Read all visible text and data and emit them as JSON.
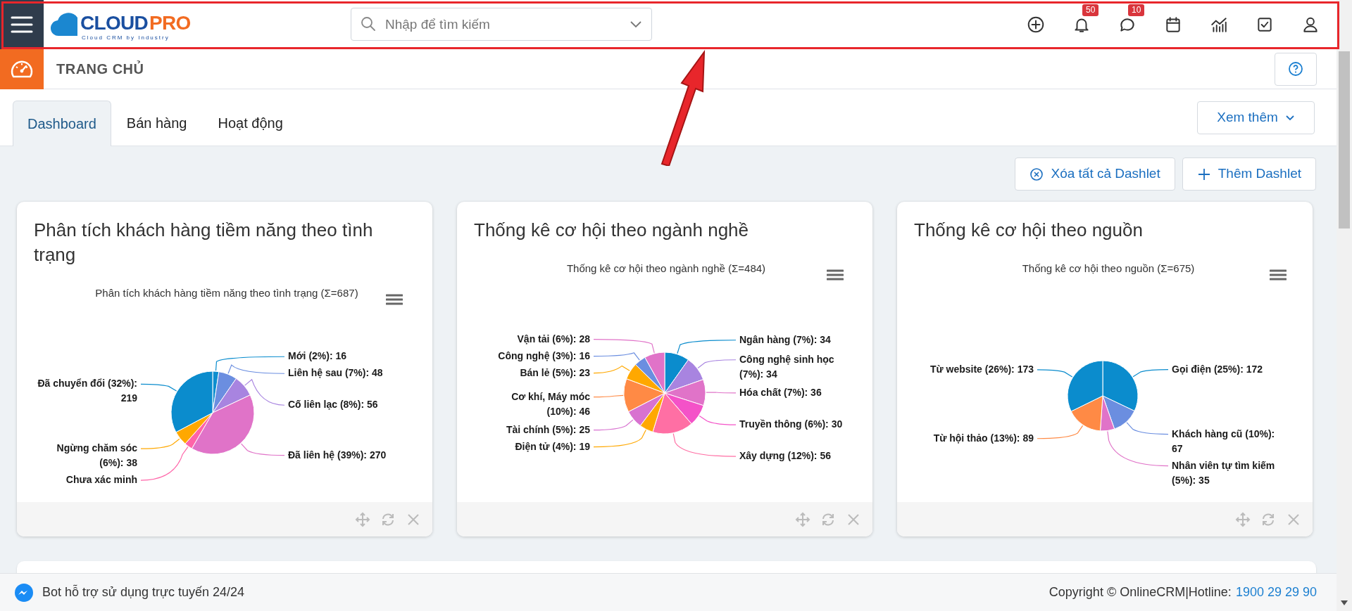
{
  "topbar": {
    "logo": {
      "first": "CLOUD",
      "second": "PRO",
      "tagline": "Cloud CRM by Industry"
    },
    "search": {
      "placeholder": "Nhập để tìm kiếm"
    },
    "icons": [
      {
        "kind": "add"
      },
      {
        "kind": "notifications",
        "badge": "50"
      },
      {
        "kind": "messages",
        "badge": "10"
      },
      {
        "kind": "calendar"
      },
      {
        "kind": "reports"
      },
      {
        "kind": "tasks"
      },
      {
        "kind": "profile"
      }
    ]
  },
  "page_title": "TRANG CHỦ",
  "tabs": [
    {
      "label": "Dashboard",
      "selected": true
    },
    {
      "label": "Bán hàng",
      "selected": false
    },
    {
      "label": "Hoạt động",
      "selected": false
    }
  ],
  "more_button": "Xem thêm",
  "actions": [
    {
      "kind": "clear",
      "label": "Xóa tất cả Dashlet"
    },
    {
      "kind": "add",
      "label": "Thêm Dashlet"
    }
  ],
  "dashlets": [
    {
      "title": "Phân tích khách hàng tiềm năng theo tình trạng",
      "chart_data": {
        "type": "pie",
        "title": "Phân tích khách hàng tiềm năng theo tình trạng (Σ=687)",
        "categories": [
          "Mới (2%): 16",
          "Liên hệ sau (7%): 48",
          "Cố liên lạc (8%): 56",
          "Đã liên hệ (39%): 270",
          "Chưa xác minh",
          "Ngừng chăm sóc (6%): 38",
          "Đã chuyển đổi (32%): 219"
        ],
        "values": [
          16,
          48,
          56,
          270,
          21,
          38,
          219
        ],
        "colors": [
          "#0d8ecf",
          "#6b8ee0",
          "#a884e0",
          "#e073c8",
          "#ff64a8",
          "#ffa800",
          "#0b8ccd"
        ]
      }
    },
    {
      "title": "Thống kê cơ hội theo ngành nghề",
      "chart_data": {
        "type": "pie",
        "title": "Thống kê cơ hội theo ngành nghề (Σ=484)",
        "categories": [
          "Ngân hàng (7%): 34",
          "Công nghệ sinh học (7%): 34",
          "Hóa chất (7%): 36",
          "Truyền thông (6%): 30",
          "Xây dựng (12%): 56",
          "Điện tử (4%): 19",
          "Tài chính (5%): 25",
          "Cơ khí, Máy móc (10%): 46",
          "Bán lẻ (5%): 23",
          "Công nghệ (3%): 16",
          "Vận tải (6%): 28"
        ],
        "values": [
          34,
          34,
          36,
          30,
          56,
          19,
          25,
          46,
          23,
          16,
          28
        ],
        "colors": [
          "#0b8ccd",
          "#a884e0",
          "#e073c8",
          "#f452c8",
          "#ff6fa4",
          "#ffa800",
          "#d872d0",
          "#ff8a45",
          "#ffa800",
          "#6b8ee0",
          "#e073c8"
        ]
      }
    },
    {
      "title": "Thống kê cơ hội theo nguồn",
      "chart_data": {
        "type": "pie",
        "title": "Thống kê cơ hội theo nguồn (Σ=675)",
        "categories": [
          "Gọi điện (25%): 172",
          "Khách hàng cũ (10%): 67",
          "Nhân viên tự tìm kiếm (5%): 35",
          "Từ hội thảo (13%): 89",
          "Từ website (26%): 173"
        ],
        "values": [
          172,
          67,
          35,
          89,
          173
        ],
        "colors": [
          "#0b8ccd",
          "#6b8ee0",
          "#e073c8",
          "#ff8a45",
          "#0b8ccd"
        ]
      }
    }
  ],
  "footer": {
    "bot_text": "Bot hỗ trợ sử dụng trực tuyến 24/24",
    "copyright": "Copyright © OnlineCRM|Hotline:",
    "hotline": "1900 29 29 90"
  }
}
